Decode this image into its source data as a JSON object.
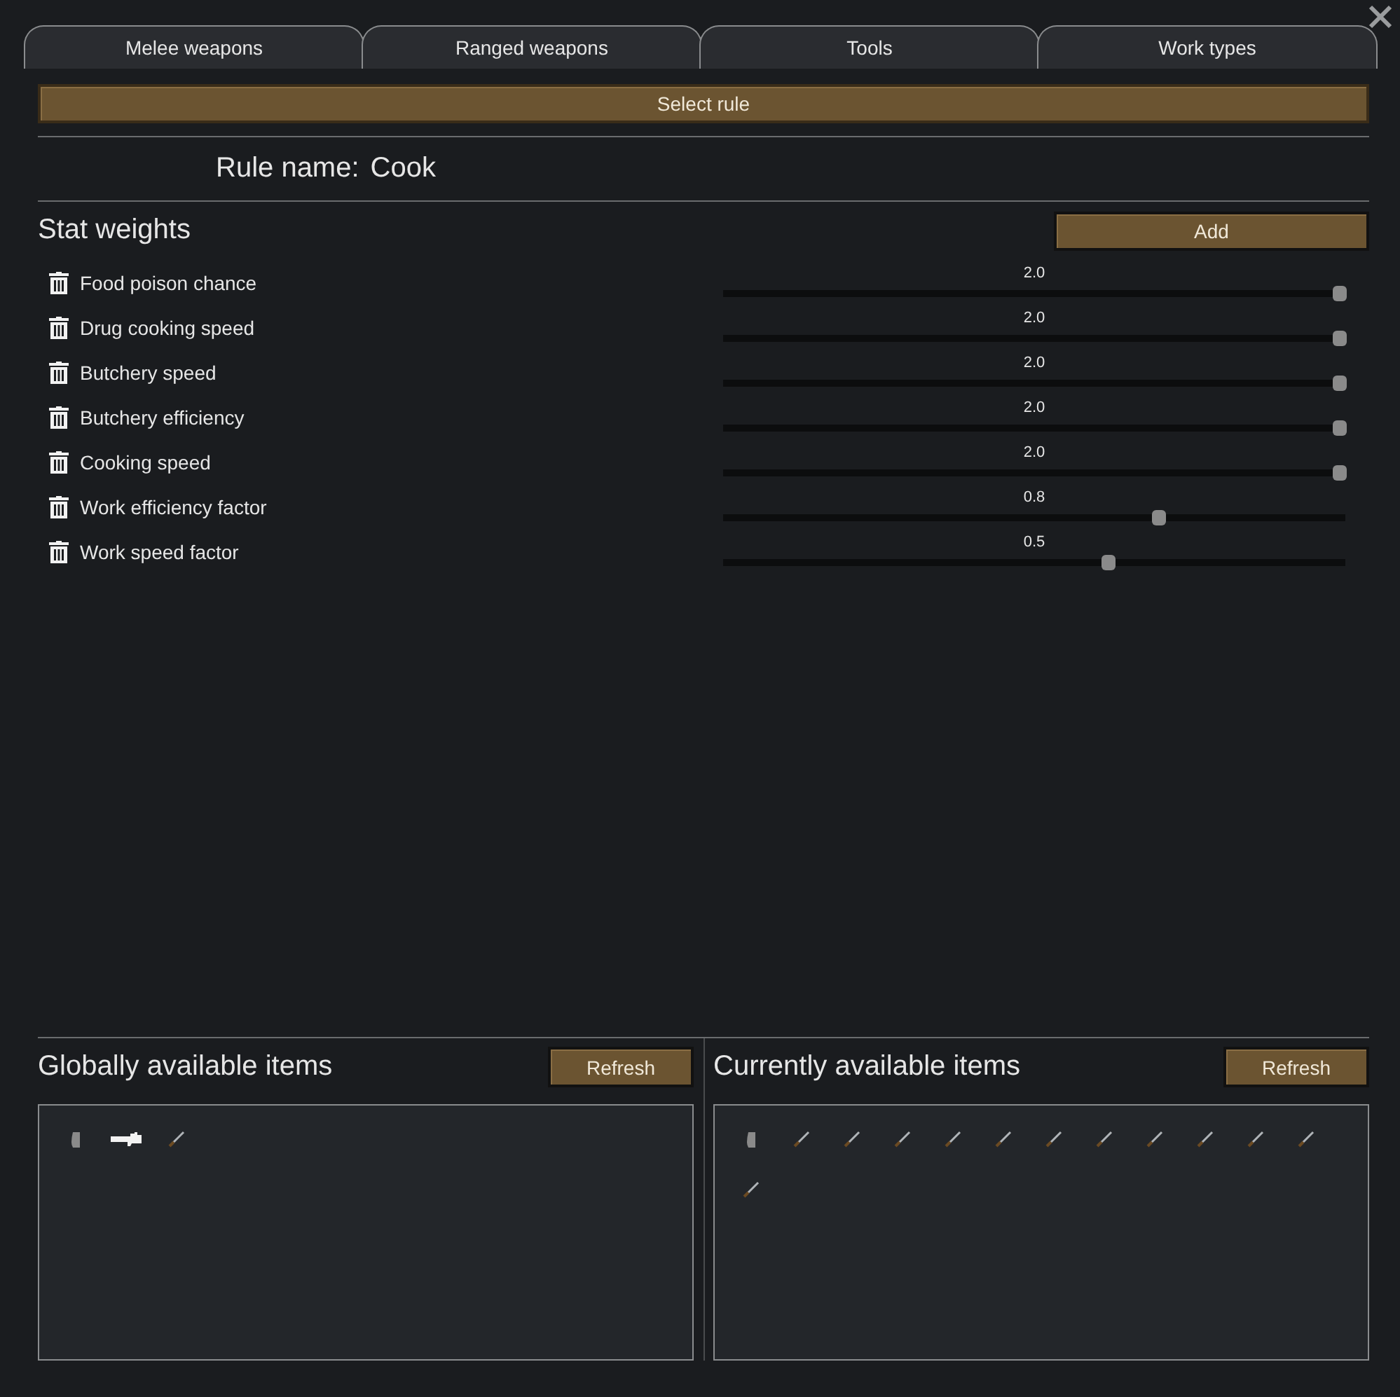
{
  "tabs": [
    {
      "label": "Melee weapons"
    },
    {
      "label": "Ranged weapons"
    },
    {
      "label": "Tools"
    },
    {
      "label": "Work types"
    }
  ],
  "select_rule_button": "Select rule",
  "rule_name": {
    "label": "Rule name:",
    "value": "Cook"
  },
  "stat_weights": {
    "title": "Stat weights",
    "add_button": "Add",
    "stats": [
      {
        "name": "Food poison chance",
        "reading": "2.0",
        "level": 0.99
      },
      {
        "name": "Drug cooking speed",
        "reading": "2.0",
        "level": 0.99
      },
      {
        "name": "Butchery speed",
        "reading": "2.0",
        "level": 0.99
      },
      {
        "name": "Butchery efficiency",
        "reading": "2.0",
        "level": 0.99
      },
      {
        "name": "Cooking speed",
        "reading": "2.0",
        "level": 0.99
      },
      {
        "name": "Work efficiency factor",
        "reading": "0.8",
        "level": 0.7
      },
      {
        "name": "Work speed factor",
        "reading": "0.5",
        "level": 0.62
      }
    ]
  },
  "globally_available": {
    "title": "Globally available items",
    "refresh_button": "Refresh",
    "items": [
      {
        "kind": "shield"
      },
      {
        "kind": "gun"
      },
      {
        "kind": "knife"
      }
    ]
  },
  "currently_available": {
    "title": "Currently available items",
    "refresh_button": "Refresh",
    "items": [
      {
        "kind": "shield"
      },
      {
        "kind": "knife"
      },
      {
        "kind": "knife"
      },
      {
        "kind": "knife"
      },
      {
        "kind": "knife"
      },
      {
        "kind": "knife"
      },
      {
        "kind": "knife"
      },
      {
        "kind": "knife"
      },
      {
        "kind": "knife"
      },
      {
        "kind": "knife"
      },
      {
        "kind": "knife"
      },
      {
        "kind": "knife"
      },
      {
        "kind": "knife"
      }
    ]
  }
}
